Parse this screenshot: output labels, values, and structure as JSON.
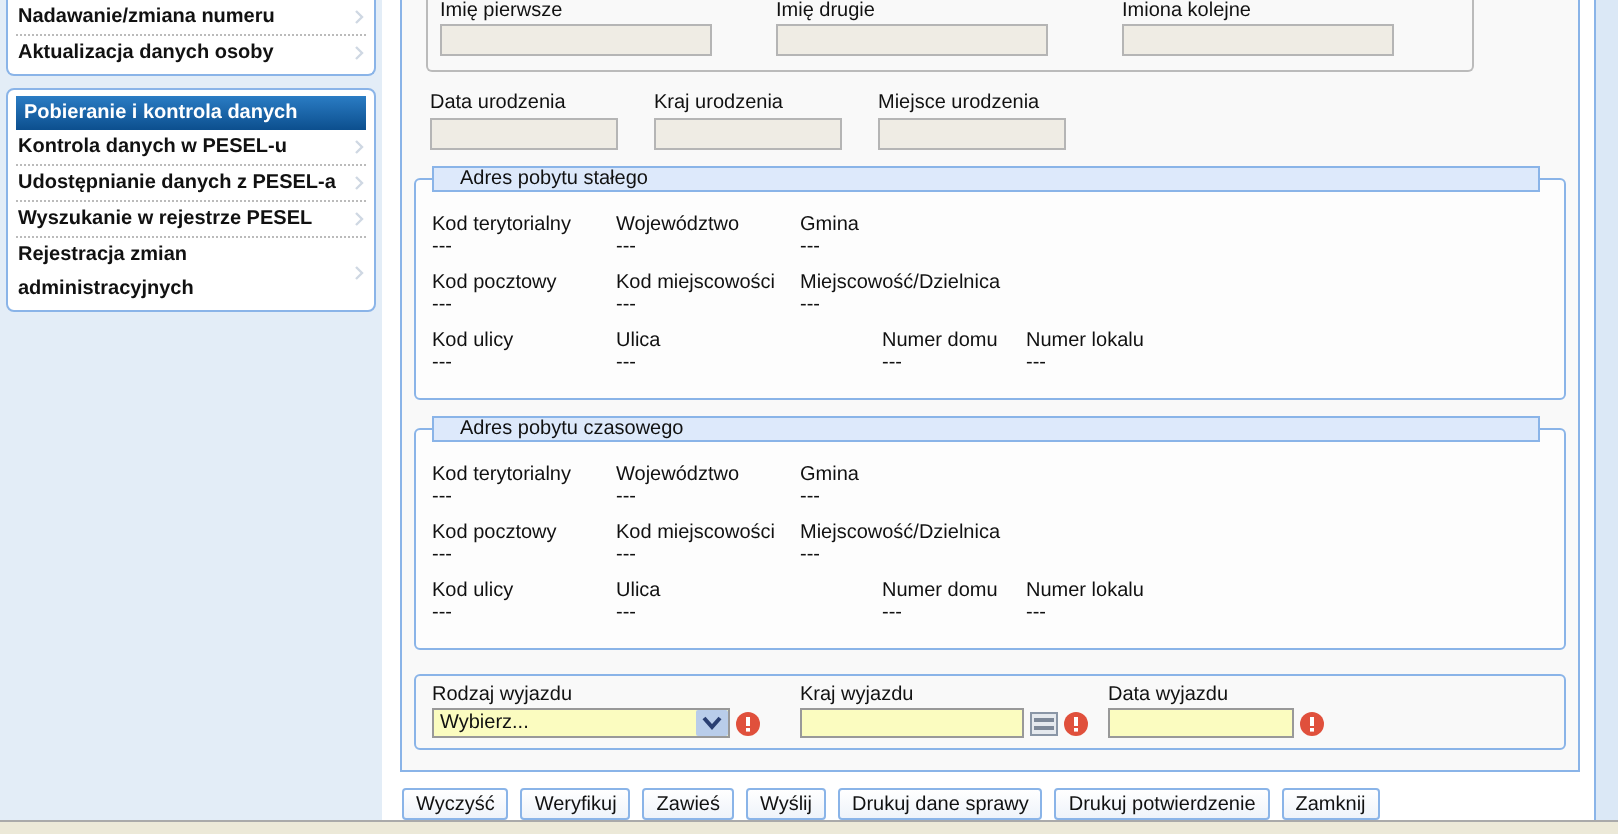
{
  "sidebar": {
    "groups": [
      {
        "items": [
          {
            "label": "Nadawanie/zmiana numeru",
            "selected": false
          },
          {
            "label": "Aktualizacja danych osoby",
            "selected": false
          }
        ]
      },
      {
        "items": [
          {
            "label": "Pobieranie i kontrola danych",
            "selected": true
          },
          {
            "label": "Kontrola danych w PESEL-u",
            "selected": false
          },
          {
            "label": "Udostępnianie danych z PESEL-a",
            "selected": false
          },
          {
            "label": "Wyszukanie w rejestrze PESEL",
            "selected": false
          },
          {
            "label": "Rejestracja zmian administracyjnych",
            "selected": false
          }
        ]
      }
    ]
  },
  "personal": {
    "name_fields": [
      {
        "label": "Imię pierwsze"
      },
      {
        "label": "Imię drugie"
      },
      {
        "label": "Imiona kolejne"
      }
    ],
    "birth_fields": [
      {
        "label": "Data urodzenia"
      },
      {
        "label": "Kraj urodzenia"
      },
      {
        "label": "Miejsce urodzenia"
      }
    ]
  },
  "addresses": [
    {
      "title": "Adres pobytu stałego",
      "rows": [
        [
          {
            "label": "Kod terytorialny",
            "value": "---"
          },
          {
            "label": "Województwo",
            "value": "---"
          },
          {
            "label": "Gmina",
            "value": "---"
          }
        ],
        [
          {
            "label": "Kod pocztowy",
            "value": "---"
          },
          {
            "label": "Kod miejscowości",
            "value": "---"
          },
          {
            "label": "Miejscowość/Dzielnica",
            "value": "---"
          }
        ],
        [
          {
            "label": "Kod ulicy",
            "value": "---"
          },
          {
            "label": "Ulica",
            "value": "---"
          },
          {
            "label": "Numer domu",
            "value": "---"
          },
          {
            "label": "Numer lokalu",
            "value": "---"
          }
        ]
      ]
    },
    {
      "title": "Adres pobytu czasowego",
      "rows": [
        [
          {
            "label": "Kod terytorialny",
            "value": "---"
          },
          {
            "label": "Województwo",
            "value": "---"
          },
          {
            "label": "Gmina",
            "value": "---"
          }
        ],
        [
          {
            "label": "Kod pocztowy",
            "value": "---"
          },
          {
            "label": "Kod miejscowości",
            "value": "---"
          },
          {
            "label": "Miejscowość/Dzielnica",
            "value": "---"
          }
        ],
        [
          {
            "label": "Kod ulicy",
            "value": "---"
          },
          {
            "label": "Ulica",
            "value": "---"
          },
          {
            "label": "Numer domu",
            "value": "---"
          },
          {
            "label": "Numer lokalu",
            "value": "---"
          }
        ]
      ]
    }
  ],
  "departure": {
    "fields": [
      {
        "kind": "select",
        "label": "Rodzaj wyjazdu",
        "value": "Wybierz...",
        "required": true
      },
      {
        "kind": "lookup",
        "label": "Kraj wyjazdu",
        "required": true
      },
      {
        "kind": "text",
        "label": "Data wyjazdu",
        "required": true
      }
    ]
  },
  "buttons": [
    "Wyczyść",
    "Weryfikuj",
    "Zawieś",
    "Wyślij",
    "Drukuj dane sprawy",
    "Drukuj potwierdzenie",
    "Zamknij"
  ]
}
